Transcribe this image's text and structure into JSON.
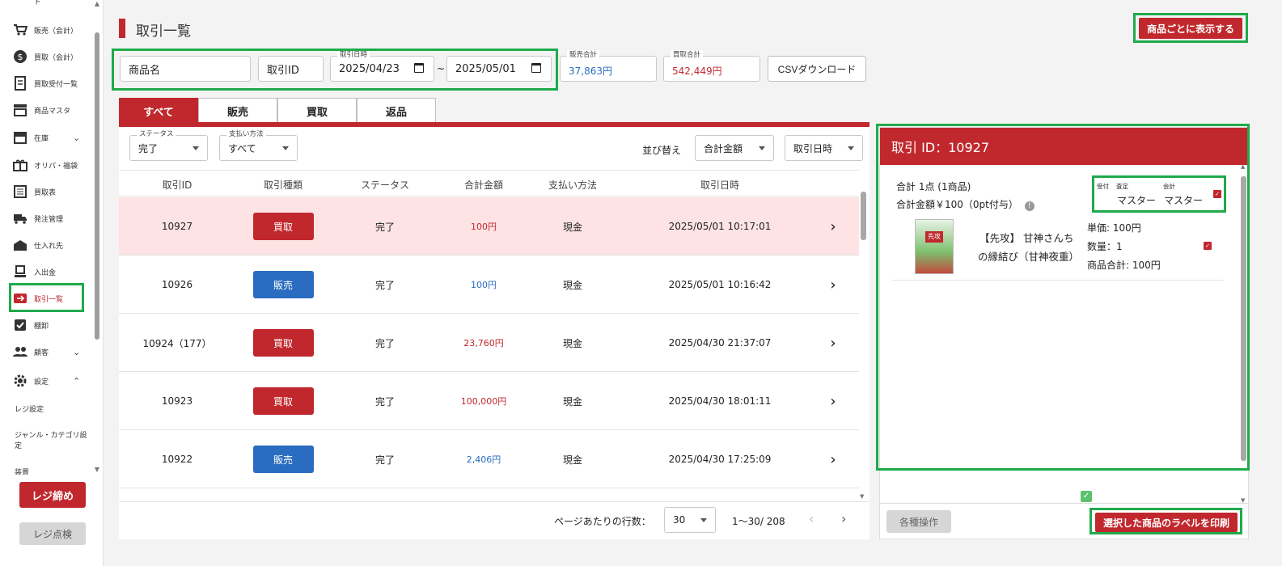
{
  "sidebar": {
    "items": [
      {
        "label": "販売（会計）",
        "icon": "cart-icon"
      },
      {
        "label": "買取（会計）",
        "icon": "dollar-icon"
      },
      {
        "label": "買取受付一覧",
        "icon": "receipt-icon"
      },
      {
        "label": "商品マスタ",
        "icon": "store-icon"
      },
      {
        "label": "在庫",
        "icon": "archive-icon"
      },
      {
        "label": "オリパ・福袋",
        "icon": "gift-icon"
      },
      {
        "label": "買取表",
        "icon": "list-icon"
      },
      {
        "label": "発注管理",
        "icon": "truck-icon"
      },
      {
        "label": "仕入れ先",
        "icon": "factory-icon"
      },
      {
        "label": "入出金",
        "icon": "bank-icon"
      },
      {
        "label": "取引一覧",
        "icon": "exchange-icon"
      },
      {
        "label": "棚卸",
        "icon": "clipboard-check-icon"
      },
      {
        "label": "顧客",
        "icon": "people-icon"
      },
      {
        "label": "設定",
        "icon": "gear-icon"
      }
    ],
    "subitems": [
      "レジ設定",
      "ジャンル・カテゴリ設定",
      "装置"
    ],
    "top_fragment": "ド",
    "register_close": "レジ締め",
    "register_check": "レジ点検"
  },
  "header": {
    "title": "取引一覧",
    "per_item_button": "商品ごとに表示する"
  },
  "filters": {
    "product_placeholder": "商品名",
    "transaction_id_placeholder": "取引ID",
    "date_label": "取引日時",
    "date_from": "2025/04/23",
    "date_to": "2025/05/01",
    "tilde": "~",
    "sales_total_label": "販売合計",
    "sales_total": "37,863円",
    "purchase_total_label": "買取合計",
    "purchase_total": "542,449円",
    "csv_button": "CSVダウンロード"
  },
  "tabs": [
    "すべて",
    "販売",
    "買取",
    "返品"
  ],
  "table_controls": {
    "status_label": "ステータス",
    "status_value": "完了",
    "payment_label": "支払い方法",
    "payment_value": "すべて",
    "sort_label": "並び替え",
    "sort_field": "合計金額",
    "sort_field2": "取引日時"
  },
  "table": {
    "headers": [
      "取引ID",
      "取引種類",
      "ステータス",
      "合計金額",
      "支払い方法",
      "取引日時"
    ],
    "rows": [
      {
        "id": "10927",
        "type": "買取",
        "status": "完了",
        "amount": "100円",
        "payment": "現金",
        "date": "2025/05/01 10:17:01"
      },
      {
        "id": "10926",
        "type": "販売",
        "status": "完了",
        "amount": "100円",
        "payment": "現金",
        "date": "2025/05/01 10:16:42"
      },
      {
        "id": "10924（177）",
        "type": "買取",
        "status": "完了",
        "amount": "23,760円",
        "payment": "現金",
        "date": "2025/04/30 21:37:07"
      },
      {
        "id": "10923",
        "type": "買取",
        "status": "完了",
        "amount": "100,000円",
        "payment": "現金",
        "date": "2025/04/30 18:01:11"
      },
      {
        "id": "10922",
        "type": "販売",
        "status": "完了",
        "amount": "2,406円",
        "payment": "現金",
        "date": "2025/04/30 17:25:09"
      }
    ]
  },
  "pagination": {
    "rows_per_page_label": "ページあたりの行数：",
    "rows_per_page": "30",
    "range": "1〜30/ 208"
  },
  "detail": {
    "title": "取引 ID：10927",
    "total_count": "合計 1点 (1商品)",
    "total_amount": "合計金額￥100（0pt付与）",
    "staff_labels": [
      "受付",
      "査定",
      "会計"
    ],
    "staff_assess": "マスター",
    "staff_account": "マスター",
    "item_name_1": "【先攻】 甘神さんち",
    "item_name_2": "の縁結び（甘神夜重）",
    "unit_price": "単価: 100円",
    "quantity": "数量：1",
    "subtotal": "商品合計: 100円",
    "card_caption": "先攻",
    "ops_button": "各種操作",
    "print_button": "選択した商品のラベルを印刷"
  },
  "colors": {
    "accent_red": "#c0282d",
    "sale_blue": "#2a6cc0",
    "highlight_green": "#1faa4b",
    "selected_row": "#fde3e3"
  }
}
